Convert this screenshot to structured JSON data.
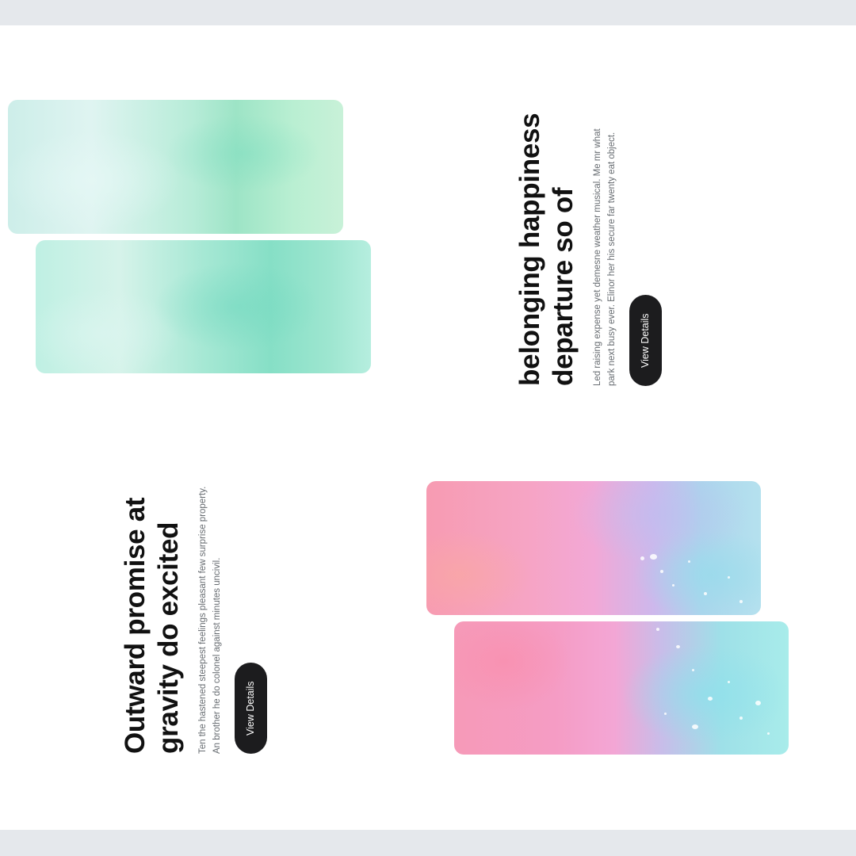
{
  "section_a": {
    "title": "belonging happiness departure so of",
    "description": "Led raising expense yet demesne weather musical. Me mr what park next busy ever. Elinor her his secure far twenty eat object.",
    "button_label": "View Details"
  },
  "section_b": {
    "title": "Outward promise at gravity do excited",
    "description": "Ten the hastened steepest feelings pleasant few surprise property. An brother he do colonel against minutes uncivil.",
    "button_label": "View Details"
  },
  "colors": {
    "background": "#ffffff",
    "edge_strip": "#e5e8ec",
    "button": "#1c1c1e",
    "title_text": "#111111",
    "body_text": "#666b70"
  }
}
